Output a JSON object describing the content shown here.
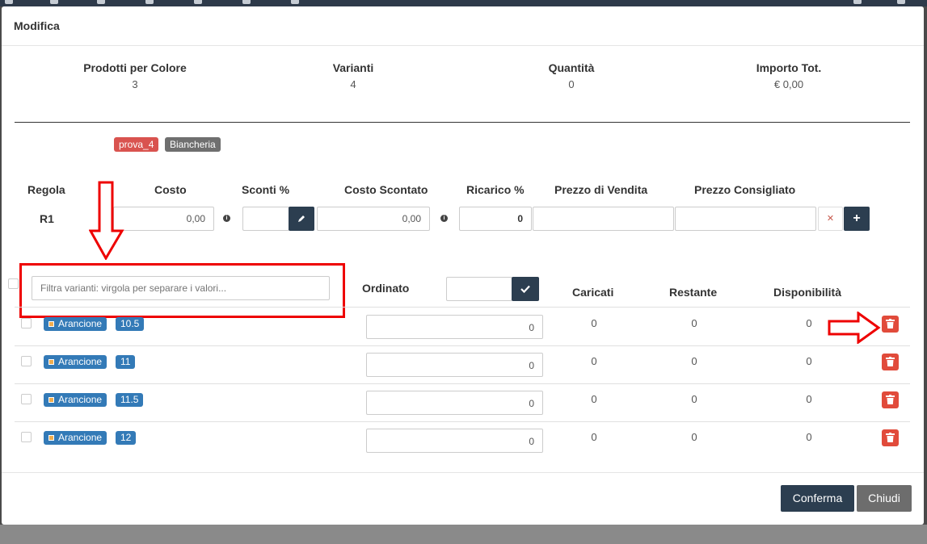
{
  "modal": {
    "title": "Modifica"
  },
  "stats": [
    {
      "label": "Prodotti per Colore",
      "value": "3"
    },
    {
      "label": "Varianti",
      "value": "4"
    },
    {
      "label": "Quantità",
      "value": "0"
    },
    {
      "label": "Importo Tot.",
      "value": "€ 0,00"
    }
  ],
  "tags": [
    {
      "text": "prova_4"
    },
    {
      "text": "Biancheria"
    }
  ],
  "pricing": {
    "headers": {
      "regola": "Regola",
      "costo": "Costo",
      "sconti": "Sconti %",
      "costo_scontato": "Costo Scontato",
      "ricarico": "Ricarico %",
      "prezzo_vendita": "Prezzo di Vendita",
      "prezzo_consigliato": "Prezzo Consigliato"
    },
    "rule": "R1",
    "costo": "0,00",
    "sconti": "",
    "costo_scontato": "0,00",
    "ricarico": "0",
    "prezzo_vendita": "",
    "prezzo_consigliato": ""
  },
  "variants": {
    "filter_placeholder": "Filtra varianti: virgola per separare i valori...",
    "headers": {
      "ordinato": "Ordinato",
      "caricati": "Caricati",
      "restante": "Restante",
      "disponibilita": "Disponibilità"
    },
    "ordinato_value": "",
    "rows": [
      {
        "color": "Arancione",
        "size": "10.5",
        "ordinato": "0",
        "caricati": "0",
        "restante": "0",
        "disponibilita": "0"
      },
      {
        "color": "Arancione",
        "size": "11",
        "ordinato": "0",
        "caricati": "0",
        "restante": "0",
        "disponibilita": "0"
      },
      {
        "color": "Arancione",
        "size": "11.5",
        "ordinato": "0",
        "caricati": "0",
        "restante": "0",
        "disponibilita": "0"
      },
      {
        "color": "Arancione",
        "size": "12",
        "ordinato": "0",
        "caricati": "0",
        "restante": "0",
        "disponibilita": "0"
      }
    ]
  },
  "footer": {
    "confirm_label": "Conferma",
    "close_label": "Chiudi"
  },
  "colors": {
    "primary": "#2c3e50",
    "danger": "#e14b3b",
    "badge": "#337ab7",
    "annotation": "#e00000"
  }
}
